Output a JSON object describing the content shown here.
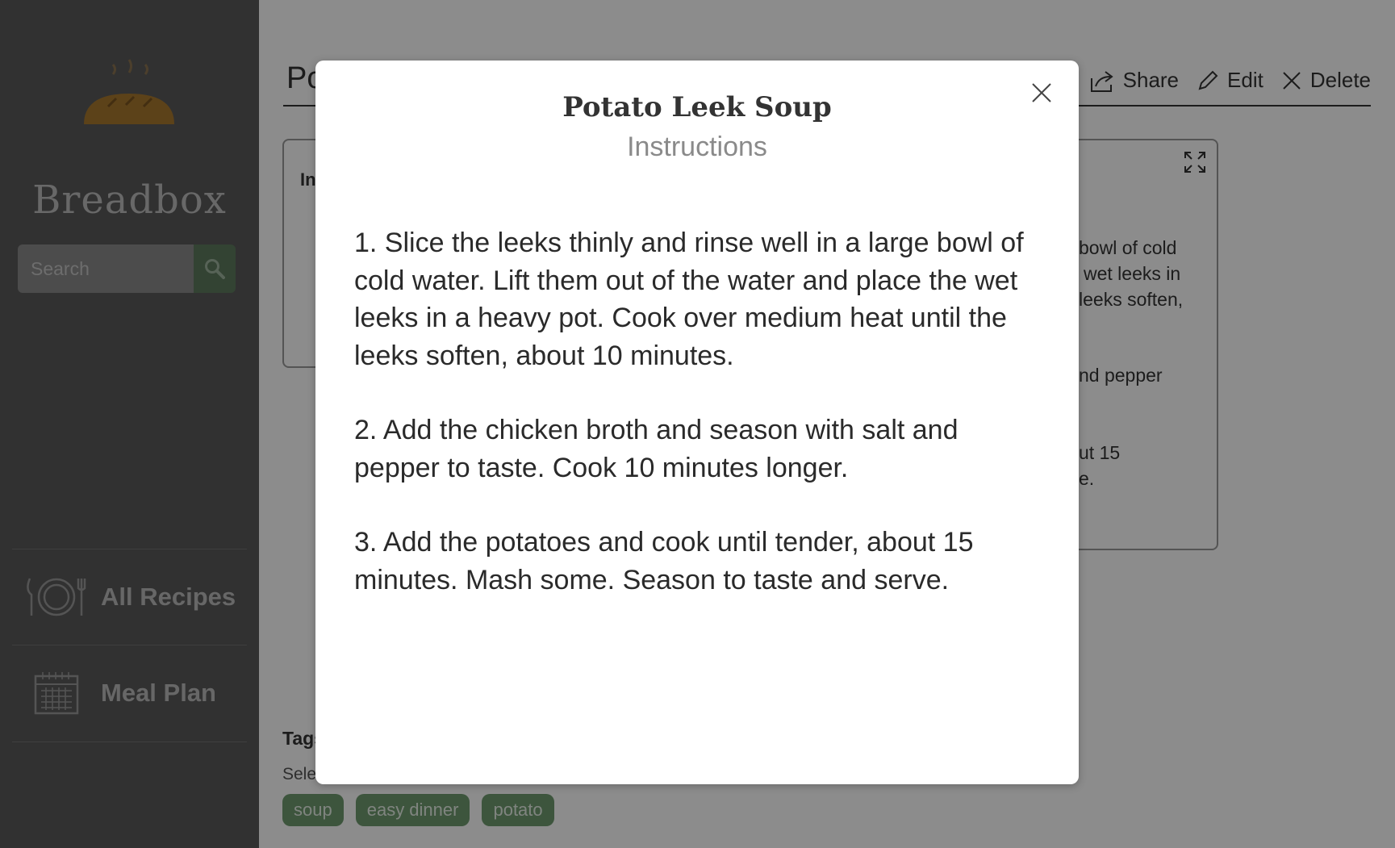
{
  "app": {
    "name": "Breadbox"
  },
  "sidebar": {
    "search": {
      "placeholder": "Search",
      "value": ""
    },
    "items": [
      {
        "label": "All Recipes",
        "icon": "plate-fork-knife-icon"
      },
      {
        "label": "Meal Plan",
        "icon": "calendar-icon"
      }
    ]
  },
  "main": {
    "title_fragment": "Po",
    "actions": [
      {
        "label": "Share",
        "icon": "share-icon"
      },
      {
        "label": "Edit",
        "icon": "pencil-icon"
      },
      {
        "label": "Delete",
        "icon": "close-icon"
      }
    ],
    "ingredients_fragment": "In",
    "instruction_fragments": [
      "bowl of cold",
      "wet leeks in",
      "leeks soften,",
      "nd pepper",
      "ut 15",
      "e."
    ],
    "tags_label_fragment": "Tags",
    "select_label_fragment": "Sele",
    "tags": [
      "soup",
      "easy dinner",
      "potato"
    ]
  },
  "modal": {
    "title": "Potato Leek Soup",
    "subtitle": "Instructions",
    "steps": [
      "1. Slice the leeks thinly and rinse well in a large bowl of cold water. Lift them out of the water and place the wet leeks in a heavy pot. Cook over medium heat until the leeks soften, about 10 minutes.",
      "2. Add the chicken broth and season with salt and pepper to taste. Cook 10 minutes longer.",
      "3. Add the potatoes and cook until tender, about 15 minutes. Mash some. Season to taste and serve."
    ]
  },
  "colors": {
    "sidebar_bg": "#5a5a5a",
    "accent_green": "#6f9b6f",
    "bread": "#a8782f"
  }
}
